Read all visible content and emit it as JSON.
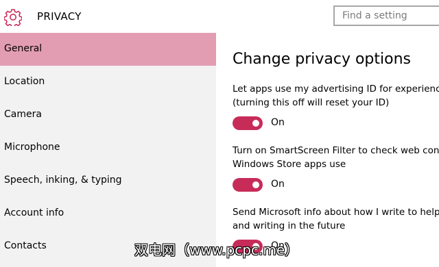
{
  "header": {
    "title": "PRIVACY",
    "icon": "gear-icon",
    "accent_color": "#c72c59",
    "search": {
      "placeholder": "Find a setting",
      "value": ""
    }
  },
  "sidebar": {
    "selected_color": "#e39db3",
    "items": [
      {
        "label": "General",
        "selected": true
      },
      {
        "label": "Location"
      },
      {
        "label": "Camera"
      },
      {
        "label": "Microphone"
      },
      {
        "label": "Speech, inking, & typing"
      },
      {
        "label": "Account info"
      },
      {
        "label": "Contacts"
      }
    ]
  },
  "main": {
    "title": "Change privacy options",
    "settings": [
      {
        "text_line1": "Let apps use my advertising ID for experience",
        "text_line2": "(turning this off will reset your ID)",
        "state": "On"
      },
      {
        "text_line1": "Turn on SmartScreen Filter to check web cont",
        "text_line2": "Windows Store apps use",
        "state": "On"
      },
      {
        "text_line1": "Send Microsoft info about how I write to help",
        "text_line2": "and writing in the future",
        "state": "On"
      }
    ]
  },
  "watermark": "双电网（www.pcpc.me）"
}
